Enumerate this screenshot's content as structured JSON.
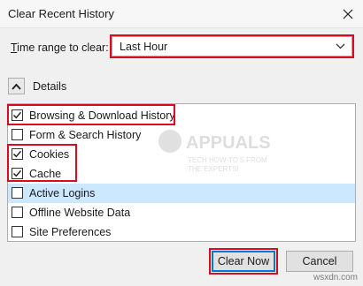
{
  "window": {
    "title": "Clear Recent History",
    "close_icon": "close-icon"
  },
  "time_range": {
    "label_accel": "T",
    "label_rest": "ime range to clear:",
    "selected": "Last Hour"
  },
  "details": {
    "label": "Details",
    "expanded": true
  },
  "items": [
    {
      "label": "Browsing & Download History",
      "checked": true,
      "selected": false
    },
    {
      "label": "Form & Search History",
      "checked": false,
      "selected": false
    },
    {
      "label": "Cookies",
      "checked": true,
      "selected": false
    },
    {
      "label": "Cache",
      "checked": true,
      "selected": false
    },
    {
      "label": "Active Logins",
      "checked": false,
      "selected": true
    },
    {
      "label": "Offline Website Data",
      "checked": false,
      "selected": false
    },
    {
      "label": "Site Preferences",
      "checked": false,
      "selected": false
    }
  ],
  "buttons": {
    "clear_now": "Clear Now",
    "cancel": "Cancel"
  },
  "watermark": {
    "brand": "APPUALS",
    "tagline_1": "TECH HOW-TO'S FROM",
    "tagline_2": "THE EXPERTS!",
    "site": "wsxdn.com"
  },
  "colors": {
    "highlight": "#d90c1f",
    "selected_row": "#cce8ff",
    "dialog_bg": "#f0f0f0",
    "focus": "#0078d7"
  }
}
